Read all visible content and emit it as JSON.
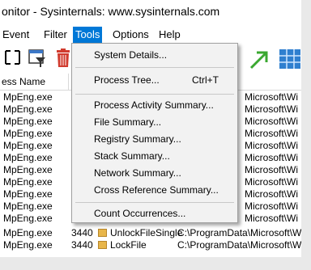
{
  "window": {
    "title": "onitor - Sysinternals: www.sysinternals.com"
  },
  "menubar": [
    {
      "label": "Event"
    },
    {
      "label": "Filter"
    },
    {
      "label": "Tools"
    },
    {
      "label": "Options"
    },
    {
      "label": "Help"
    }
  ],
  "columns": {
    "process_name": "ess Name"
  },
  "rows": [
    {
      "name": "MpEng.exe",
      "pid": "",
      "op": "",
      "path": "",
      "detail": "Microsoft\\Wi"
    },
    {
      "name": "MpEng.exe",
      "pid": "",
      "op": "",
      "path": "",
      "detail": "Microsoft\\Wi"
    },
    {
      "name": "MpEng.exe",
      "pid": "",
      "op": "",
      "path": "",
      "detail": "Microsoft\\Wi"
    },
    {
      "name": "MpEng.exe",
      "pid": "",
      "op": "",
      "path": "",
      "detail": "Microsoft\\Wi"
    },
    {
      "name": "MpEng.exe",
      "pid": "",
      "op": "",
      "path": "",
      "detail": "Microsoft\\Wi"
    },
    {
      "name": "MpEng.exe",
      "pid": "",
      "op": "",
      "path": "",
      "detail": "Microsoft\\Wi"
    },
    {
      "name": "MpEng.exe",
      "pid": "",
      "op": "",
      "path": "",
      "detail": "Microsoft\\Wi"
    },
    {
      "name": "MpEng.exe",
      "pid": "",
      "op": "",
      "path": "",
      "detail": "Microsoft\\Wi"
    },
    {
      "name": "MpEng.exe",
      "pid": "",
      "op": "",
      "path": "",
      "detail": "Microsoft\\Wi"
    },
    {
      "name": "MpEng.exe",
      "pid": "",
      "op": "",
      "path": "",
      "detail": "Microsoft\\Wi"
    },
    {
      "name": "MpEng.exe",
      "pid": "",
      "op": "",
      "path": "",
      "detail": "Microsoft\\Wi"
    },
    {
      "name": "MpEng.exe",
      "pid": "3440",
      "op": "UnlockFileSingle",
      "path": "C:\\ProgramData\\Microsoft\\Wi",
      "detail": ""
    },
    {
      "name": "MpEng.exe",
      "pid": "3440",
      "op": "LockFile",
      "path": "C:\\ProgramData\\Microsoft\\Wi",
      "detail": ""
    }
  ],
  "tools_menu": {
    "system_details": "System Details...",
    "process_tree": "Process Tree...",
    "process_tree_shortcut": "Ctrl+T",
    "process_activity": "Process Activity Summary...",
    "file_summary": "File Summary...",
    "registry_summary": "Registry Summary...",
    "stack_summary": "Stack Summary...",
    "network_summary": "Network Summary...",
    "cross_reference": "Cross Reference Summary...",
    "count_occurrences": "Count Occurrences..."
  },
  "colors": {
    "menu_highlight": "#0078d7",
    "menu_bg": "#f2f2f2"
  },
  "icons": [
    "capture-bracket-icon",
    "highlight-filter-icon",
    "trash-icon",
    "jump-arrow-icon",
    "grid-icon"
  ]
}
